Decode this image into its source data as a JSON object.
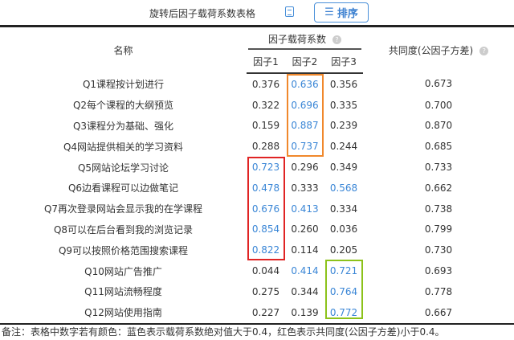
{
  "toolbar": {
    "title": "旋转后因子载荷系数表格",
    "sort_label": "排序"
  },
  "header": {
    "name": "名称",
    "group": "因子载荷系数",
    "factors": [
      "因子1",
      "因子2",
      "因子3"
    ],
    "communality": "共同度(公因子方差)",
    "help": "?"
  },
  "rows": [
    {
      "name": "Q1课程按计划进行",
      "f": [
        "0.376",
        "0.636",
        "0.356"
      ],
      "c": "0.673",
      "blue": [
        false,
        true,
        false
      ]
    },
    {
      "name": "Q2每个课程的大纲预览",
      "f": [
        "0.322",
        "0.696",
        "0.335"
      ],
      "c": "0.700",
      "blue": [
        false,
        true,
        false
      ]
    },
    {
      "name": "Q3课程分为基础、强化",
      "f": [
        "0.159",
        "0.887",
        "0.239"
      ],
      "c": "0.870",
      "blue": [
        false,
        true,
        false
      ]
    },
    {
      "name": "Q4网站提供相关的学习资料",
      "f": [
        "0.288",
        "0.737",
        "0.244"
      ],
      "c": "0.685",
      "blue": [
        false,
        true,
        false
      ]
    },
    {
      "name": "Q5网站论坛学习讨论",
      "f": [
        "0.723",
        "0.296",
        "0.349"
      ],
      "c": "0.733",
      "blue": [
        true,
        false,
        false
      ]
    },
    {
      "name": "Q6边看课程可以边做笔记",
      "f": [
        "0.478",
        "0.333",
        "0.568"
      ],
      "c": "0.662",
      "blue": [
        true,
        false,
        true
      ]
    },
    {
      "name": "Q7再次登录网站会显示我的在学课程",
      "f": [
        "0.676",
        "0.413",
        "0.334"
      ],
      "c": "0.738",
      "blue": [
        true,
        true,
        false
      ]
    },
    {
      "name": "Q8可以在后台看到我的浏览记录",
      "f": [
        "0.854",
        "0.260",
        "0.036"
      ],
      "c": "0.799",
      "blue": [
        true,
        false,
        false
      ]
    },
    {
      "name": "Q9可以按照价格范围搜索课程",
      "f": [
        "0.822",
        "0.114",
        "0.205"
      ],
      "c": "0.730",
      "blue": [
        true,
        false,
        false
      ]
    },
    {
      "name": "Q10网站广告推广",
      "f": [
        "0.044",
        "0.414",
        "0.721"
      ],
      "c": "0.693",
      "blue": [
        false,
        true,
        true
      ]
    },
    {
      "name": "Q11网站流畅程度",
      "f": [
        "0.275",
        "0.344",
        "0.764"
      ],
      "c": "0.778",
      "blue": [
        false,
        false,
        true
      ]
    },
    {
      "name": "Q12网站使用指南",
      "f": [
        "0.227",
        "0.139",
        "0.772"
      ],
      "c": "0.667",
      "blue": [
        false,
        false,
        true
      ]
    }
  ],
  "note": "备注：表格中数字若有颜色：蓝色表示载荷系数绝对值大于0.4，红色表示共同度(公因子方差)小于0.4。",
  "colors": {
    "blue": "#3a86d6",
    "orange": "#f0882c",
    "red": "#e02424",
    "green": "#8cc21a"
  }
}
